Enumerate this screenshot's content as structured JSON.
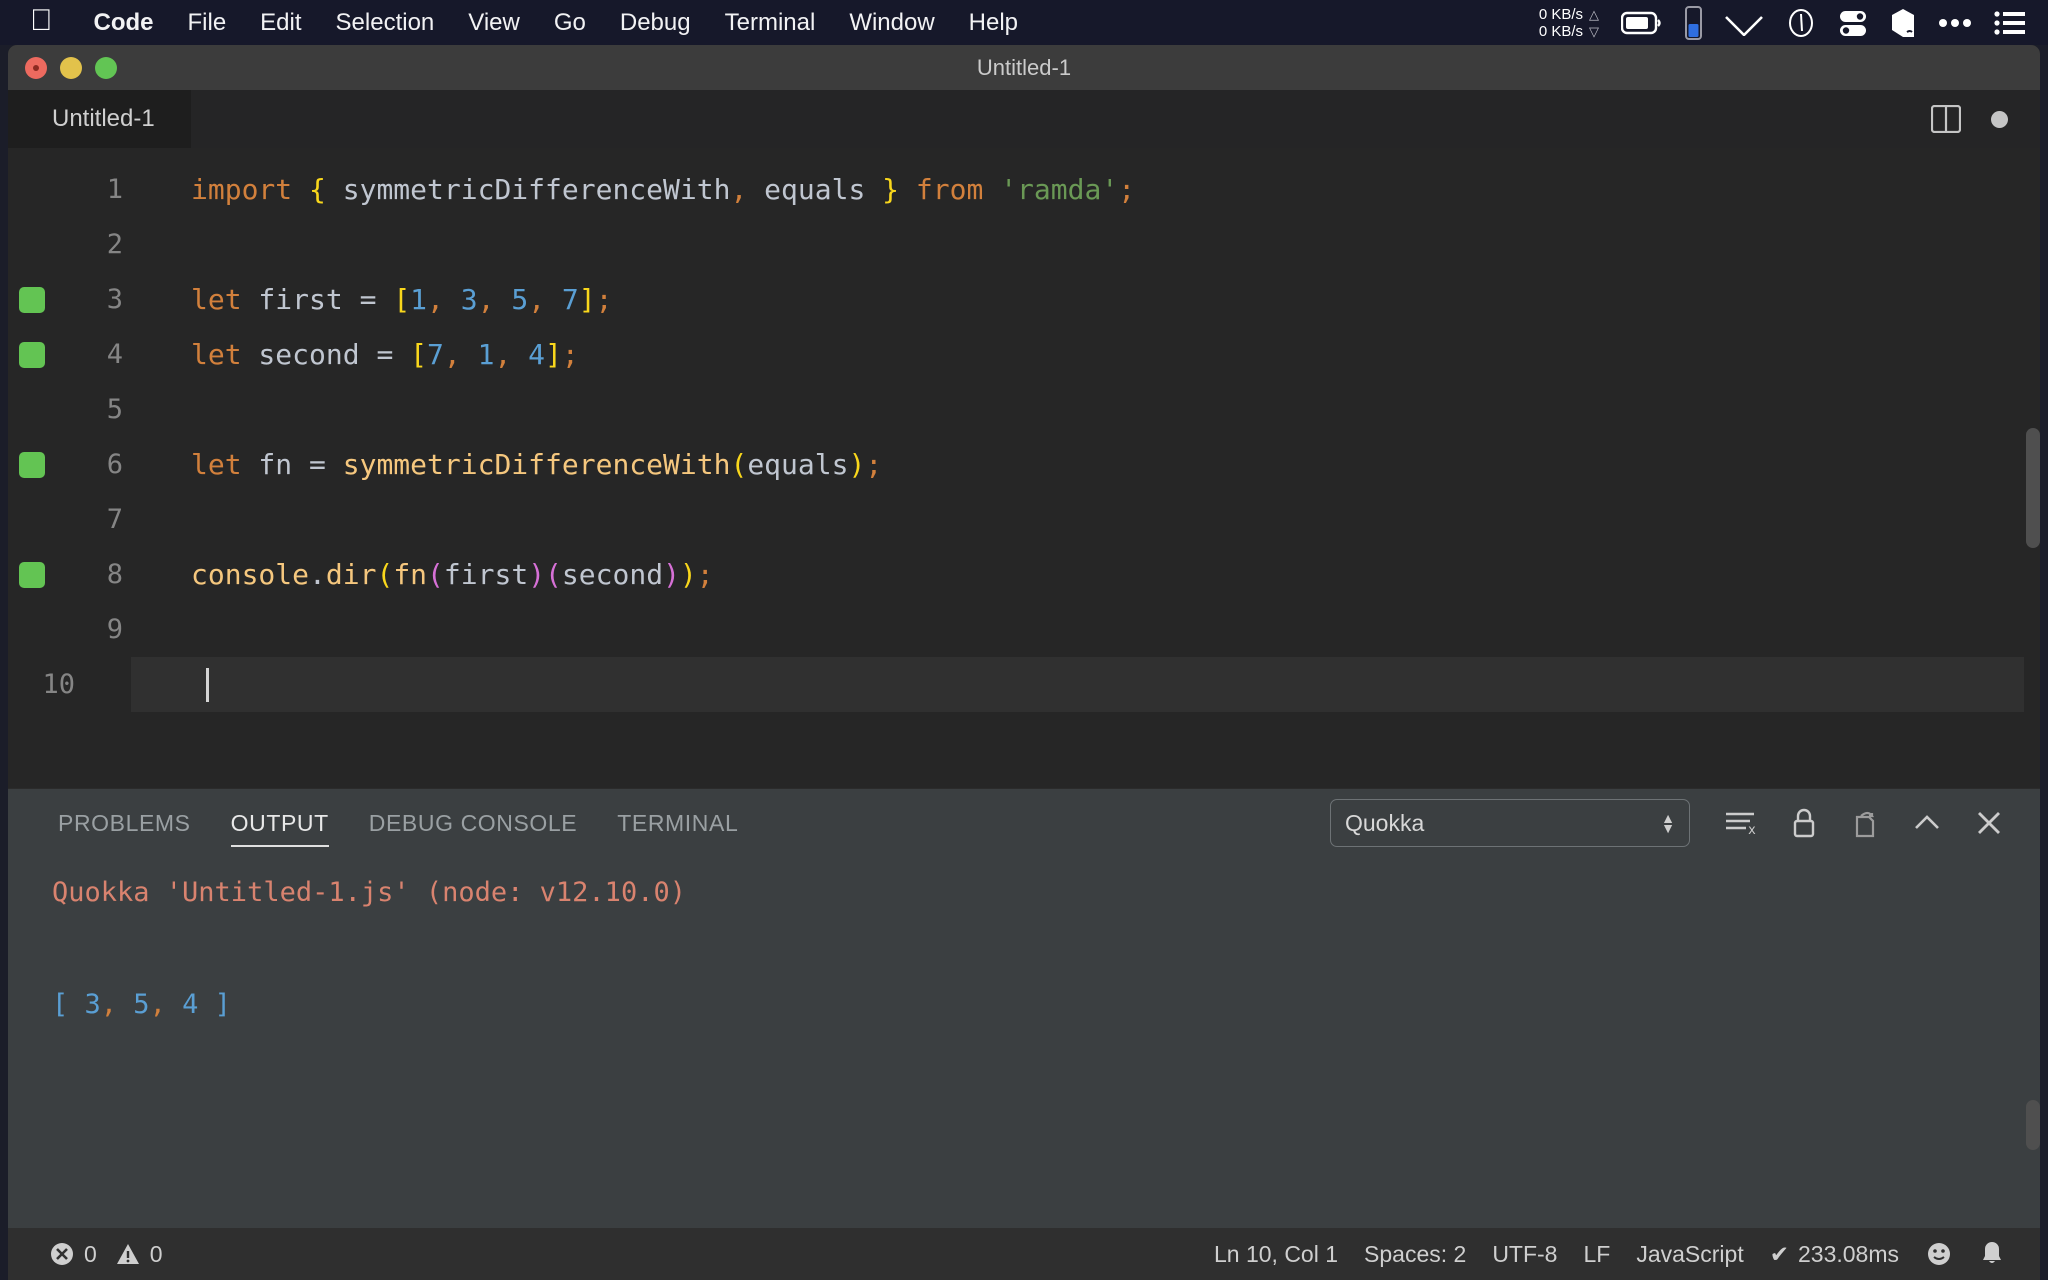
{
  "menubar": {
    "apple_icon": "apple-logo-icon",
    "items": [
      {
        "label": "Code",
        "bold": true
      },
      {
        "label": "File",
        "bold": false
      },
      {
        "label": "Edit",
        "bold": false
      },
      {
        "label": "Selection",
        "bold": false
      },
      {
        "label": "View",
        "bold": false
      },
      {
        "label": "Go",
        "bold": false
      },
      {
        "label": "Debug",
        "bold": false
      },
      {
        "label": "Terminal",
        "bold": false
      },
      {
        "label": "Window",
        "bold": false
      },
      {
        "label": "Help",
        "bold": false
      }
    ],
    "network": {
      "up": "0 KB/s",
      "down": "0 KB/s",
      "up_arrow": "△",
      "down_arrow": "▽"
    },
    "status_icons": [
      "battery-icon",
      "battery-meter-icon",
      "wifi-icon",
      "clock-icon",
      "toggles-icon",
      "shield-icon",
      "ellipsis-icon",
      "list-menu-icon"
    ]
  },
  "window": {
    "title": "Untitled-1"
  },
  "tabs": {
    "active_tab": "Untitled-1",
    "actions": [
      "split-editor-icon",
      "unsaved-dot-icon"
    ]
  },
  "editor": {
    "lines": [
      {
        "number": "1",
        "quokka_mark": false,
        "tokens": [
          {
            "text": "import",
            "cls": "t-kw"
          },
          {
            "text": " ",
            "cls": "t-plain"
          },
          {
            "text": "{",
            "cls": "t-br1"
          },
          {
            "text": " symmetricDifferenceWith",
            "cls": "t-plain"
          },
          {
            "text": ",",
            "cls": "t-punct"
          },
          {
            "text": " equals ",
            "cls": "t-plain"
          },
          {
            "text": "}",
            "cls": "t-br1"
          },
          {
            "text": " ",
            "cls": "t-plain"
          },
          {
            "text": "from",
            "cls": "t-kw"
          },
          {
            "text": " ",
            "cls": "t-plain"
          },
          {
            "text": "'ramda'",
            "cls": "t-str"
          },
          {
            "text": ";",
            "cls": "t-punct"
          }
        ]
      },
      {
        "number": "2",
        "quokka_mark": false,
        "tokens": []
      },
      {
        "number": "3",
        "quokka_mark": true,
        "tokens": [
          {
            "text": "let",
            "cls": "t-kw"
          },
          {
            "text": " first ",
            "cls": "t-plain"
          },
          {
            "text": "=",
            "cls": "t-plain"
          },
          {
            "text": " ",
            "cls": "t-plain"
          },
          {
            "text": "[",
            "cls": "t-br1"
          },
          {
            "text": "1",
            "cls": "t-num"
          },
          {
            "text": ",",
            "cls": "t-punct"
          },
          {
            "text": " ",
            "cls": "t-plain"
          },
          {
            "text": "3",
            "cls": "t-num"
          },
          {
            "text": ",",
            "cls": "t-punct"
          },
          {
            "text": " ",
            "cls": "t-plain"
          },
          {
            "text": "5",
            "cls": "t-num"
          },
          {
            "text": ",",
            "cls": "t-punct"
          },
          {
            "text": " ",
            "cls": "t-plain"
          },
          {
            "text": "7",
            "cls": "t-num"
          },
          {
            "text": "]",
            "cls": "t-br1"
          },
          {
            "text": ";",
            "cls": "t-punct"
          }
        ]
      },
      {
        "number": "4",
        "quokka_mark": true,
        "tokens": [
          {
            "text": "let",
            "cls": "t-kw"
          },
          {
            "text": " second ",
            "cls": "t-plain"
          },
          {
            "text": "=",
            "cls": "t-plain"
          },
          {
            "text": " ",
            "cls": "t-plain"
          },
          {
            "text": "[",
            "cls": "t-br1"
          },
          {
            "text": "7",
            "cls": "t-num"
          },
          {
            "text": ",",
            "cls": "t-punct"
          },
          {
            "text": " ",
            "cls": "t-plain"
          },
          {
            "text": "1",
            "cls": "t-num"
          },
          {
            "text": ",",
            "cls": "t-punct"
          },
          {
            "text": " ",
            "cls": "t-plain"
          },
          {
            "text": "4",
            "cls": "t-num"
          },
          {
            "text": "]",
            "cls": "t-br1"
          },
          {
            "text": ";",
            "cls": "t-punct"
          }
        ]
      },
      {
        "number": "5",
        "quokka_mark": false,
        "tokens": []
      },
      {
        "number": "6",
        "quokka_mark": true,
        "tokens": [
          {
            "text": "let",
            "cls": "t-kw"
          },
          {
            "text": " fn ",
            "cls": "t-plain"
          },
          {
            "text": "=",
            "cls": "t-plain"
          },
          {
            "text": " ",
            "cls": "t-plain"
          },
          {
            "text": "symmetricDifferenceWith",
            "cls": "t-fn"
          },
          {
            "text": "(",
            "cls": "t-br1"
          },
          {
            "text": "equals",
            "cls": "t-plain"
          },
          {
            "text": ")",
            "cls": "t-br1"
          },
          {
            "text": ";",
            "cls": "t-punct"
          }
        ]
      },
      {
        "number": "7",
        "quokka_mark": false,
        "tokens": []
      },
      {
        "number": "8",
        "quokka_mark": true,
        "tokens": [
          {
            "text": "console",
            "cls": "t-fn"
          },
          {
            "text": ".",
            "cls": "t-plain"
          },
          {
            "text": "dir",
            "cls": "t-fn"
          },
          {
            "text": "(",
            "cls": "t-br1"
          },
          {
            "text": "fn",
            "cls": "t-fn"
          },
          {
            "text": "(",
            "cls": "t-br2"
          },
          {
            "text": "first",
            "cls": "t-plain"
          },
          {
            "text": ")",
            "cls": "t-br2"
          },
          {
            "text": "(",
            "cls": "t-br2"
          },
          {
            "text": "second",
            "cls": "t-plain"
          },
          {
            "text": ")",
            "cls": "t-br2"
          },
          {
            "text": ")",
            "cls": "t-br1"
          },
          {
            "text": ";",
            "cls": "t-punct"
          }
        ]
      },
      {
        "number": "9",
        "quokka_mark": false,
        "tokens": []
      },
      {
        "number": "10",
        "quokka_mark": false,
        "tokens": [],
        "cursor": true
      }
    ]
  },
  "panel": {
    "tabs": [
      {
        "label": "PROBLEMS",
        "active": false
      },
      {
        "label": "OUTPUT",
        "active": true
      },
      {
        "label": "DEBUG CONSOLE",
        "active": false
      },
      {
        "label": "TERMINAL",
        "active": false
      }
    ],
    "channel_select": {
      "value": "Quokka"
    },
    "actions": [
      "clear-output-icon",
      "lock-scroll-icon",
      "open-in-editor-icon",
      "collapse-panel-icon",
      "close-panel-icon"
    ],
    "output_lines": [
      {
        "segments": [
          {
            "text": "Quokka 'Untitled-1.js' (node: v12.10.0)",
            "cls": "o-salmon"
          }
        ]
      },
      {
        "segments": []
      },
      {
        "segments": [
          {
            "text": "[ ",
            "cls": "o-blue"
          },
          {
            "text": "3",
            "cls": "o-blue"
          },
          {
            "text": ",",
            "cls": "o-comma"
          },
          {
            "text": " 5",
            "cls": "o-blue"
          },
          {
            "text": ",",
            "cls": "o-comma"
          },
          {
            "text": " 4",
            "cls": "o-blue"
          },
          {
            "text": " ]",
            "cls": "o-blue"
          }
        ]
      }
    ]
  },
  "statusbar": {
    "errors": "0",
    "warnings": "0",
    "cursor_position": "Ln 10, Col 1",
    "indentation": "Spaces: 2",
    "encoding": "UTF-8",
    "eol": "LF",
    "language": "JavaScript",
    "quokka_time": "233.08ms",
    "quokka_check": "✔",
    "right_icons": [
      "smiley-feedback-icon",
      "bell-notification-icon"
    ]
  },
  "colors": {
    "menubar_bg": "#16182a",
    "titlebar_bg": "#3c3c3c",
    "editor_bg": "#262626",
    "panel_bg": "#3b3f41",
    "statusbar_bg": "#2f2f2f",
    "quokka_green": "#63c453",
    "accent_orange": "#d2803c"
  }
}
